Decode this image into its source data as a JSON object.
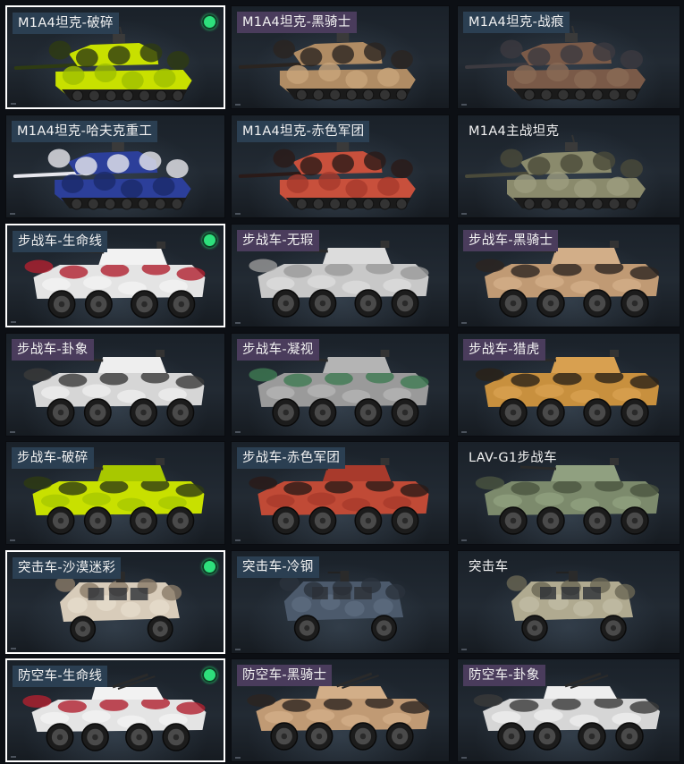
{
  "skins": [
    {
      "label": "M1A4坦克-破碎",
      "vehicle": "tank",
      "tag": "blue",
      "selected": true,
      "owned": true,
      "colors": [
        "#c8e000",
        "#2e3b12",
        "#9fbf00"
      ]
    },
    {
      "label": "M1A4坦克-黑骑士",
      "vehicle": "tank",
      "tag": "purple",
      "selected": false,
      "owned": false,
      "colors": [
        "#b08c64",
        "#2a2420",
        "#c9a57a"
      ]
    },
    {
      "label": "M1A4坦克-战痕",
      "vehicle": "tank",
      "tag": "blue",
      "selected": false,
      "owned": false,
      "colors": [
        "#7a5a48",
        "#3c3a40",
        "#8a6a55"
      ]
    },
    {
      "label": "M1A4坦克-哈夫克重工",
      "vehicle": "tank",
      "tag": "blue",
      "selected": false,
      "owned": false,
      "colors": [
        "#2c3f9a",
        "#e8e8ee",
        "#1c2a6a"
      ]
    },
    {
      "label": "M1A4坦克-赤色军团",
      "vehicle": "tank",
      "tag": "blue",
      "selected": false,
      "owned": false,
      "colors": [
        "#c8503c",
        "#2a1a18",
        "#a83a2c"
      ]
    },
    {
      "label": "M1A4主战坦克",
      "vehicle": "tank",
      "tag": "none",
      "selected": false,
      "owned": false,
      "colors": [
        "#8a8a6c",
        "#4a4a3a",
        "#9c9c80"
      ]
    },
    {
      "label": "步战车-生命线",
      "vehicle": "ifv",
      "tag": "blue",
      "selected": true,
      "owned": true,
      "colors": [
        "#e4e4e4",
        "#b02030",
        "#f2f2f2"
      ]
    },
    {
      "label": "步战车-无瑕",
      "vehicle": "ifv",
      "tag": "purple",
      "selected": false,
      "owned": false,
      "colors": [
        "#c8c8c8",
        "#9a9a9a",
        "#dcdcdc"
      ]
    },
    {
      "label": "步战车-黑骑士",
      "vehicle": "ifv",
      "tag": "purple",
      "selected": false,
      "owned": false,
      "colors": [
        "#c09a74",
        "#2c2420",
        "#d2ae88"
      ]
    },
    {
      "label": "步战车-卦象",
      "vehicle": "ifv",
      "tag": "purple",
      "selected": false,
      "owned": false,
      "colors": [
        "#d6d6d6",
        "#3a3a3a",
        "#eeeeee"
      ]
    },
    {
      "label": "步战车-凝视",
      "vehicle": "ifv",
      "tag": "purple",
      "selected": false,
      "owned": false,
      "colors": [
        "#9a9a9a",
        "#3e7a52",
        "#b4b4b4"
      ]
    },
    {
      "label": "步战车-猎虎",
      "vehicle": "ifv",
      "tag": "purple",
      "selected": false,
      "owned": false,
      "colors": [
        "#c8903e",
        "#2a2218",
        "#d8a050"
      ]
    },
    {
      "label": "步战车-破碎",
      "vehicle": "ifv",
      "tag": "blue",
      "selected": false,
      "owned": false,
      "colors": [
        "#c8e000",
        "#2e3b12",
        "#a8c800"
      ]
    },
    {
      "label": "步战车-赤色军团",
      "vehicle": "ifv",
      "tag": "blue",
      "selected": false,
      "owned": false,
      "colors": [
        "#c04a36",
        "#2a1a18",
        "#a83a2c"
      ]
    },
    {
      "label": "LAV-G1步战车",
      "vehicle": "ifv",
      "tag": "none",
      "selected": false,
      "owned": false,
      "colors": [
        "#7c8a6c",
        "#4a5440",
        "#90a080"
      ]
    },
    {
      "label": "突击车-沙漠迷彩",
      "vehicle": "mrap",
      "tag": "blue",
      "selected": true,
      "owned": true,
      "colors": [
        "#d8ccba",
        "#8a7a68",
        "#e6dccc"
      ]
    },
    {
      "label": "突击车-冷钢",
      "vehicle": "mrap",
      "tag": "blue",
      "selected": false,
      "owned": false,
      "colors": [
        "#4c5a6c",
        "#2a323c",
        "#5c6c80"
      ]
    },
    {
      "label": "突击车",
      "vehicle": "mrap",
      "tag": "none",
      "selected": false,
      "owned": false,
      "colors": [
        "#b0aa90",
        "#6a6654",
        "#c0bca4"
      ]
    },
    {
      "label": "防空车-生命线",
      "vehicle": "aa",
      "tag": "blue",
      "selected": true,
      "owned": true,
      "colors": [
        "#e4e4e4",
        "#b02030",
        "#f2f2f2"
      ]
    },
    {
      "label": "防空车-黑骑士",
      "vehicle": "aa",
      "tag": "purple",
      "selected": false,
      "owned": false,
      "colors": [
        "#c09a74",
        "#2c2420",
        "#d2ae88"
      ]
    },
    {
      "label": "防空车-卦象",
      "vehicle": "aa",
      "tag": "purple",
      "selected": false,
      "owned": false,
      "colors": [
        "#d6d6d6",
        "#3a3a3a",
        "#eeeeee"
      ]
    }
  ]
}
